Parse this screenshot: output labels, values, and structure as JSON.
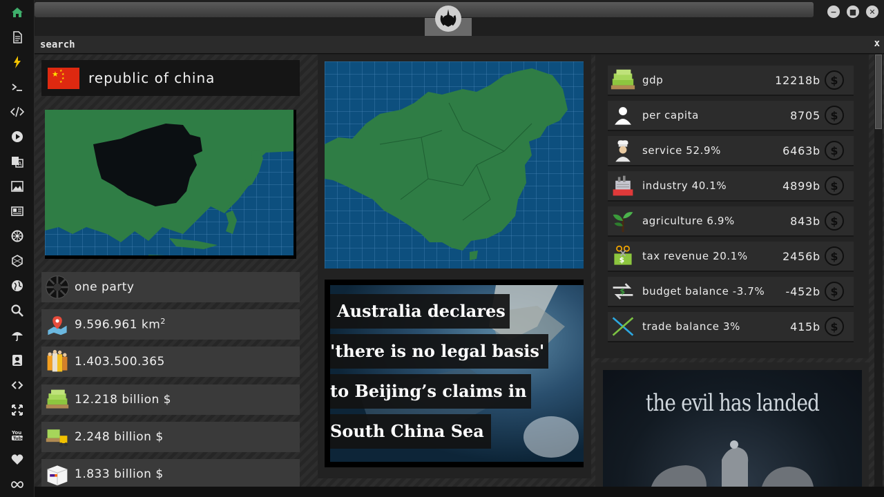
{
  "search": {
    "placeholder": "search",
    "close_label": "x"
  },
  "sidebar": {
    "items": [
      {
        "name": "home-icon"
      },
      {
        "name": "document-icon"
      },
      {
        "name": "lightning-icon"
      },
      {
        "name": "terminal-icon"
      },
      {
        "name": "code-icon"
      },
      {
        "name": "play-icon"
      },
      {
        "name": "translate-icon"
      },
      {
        "name": "image-icon"
      },
      {
        "name": "news-icon"
      },
      {
        "name": "gear-icon"
      },
      {
        "name": "hexagon-icon"
      },
      {
        "name": "globe-icon"
      },
      {
        "name": "search-icon"
      },
      {
        "name": "umbrella-icon"
      },
      {
        "name": "contact-icon"
      },
      {
        "name": "link-icon"
      },
      {
        "name": "expand-icon"
      },
      {
        "name": "youtube-icon"
      },
      {
        "name": "heart-icon"
      },
      {
        "name": "infinity-icon"
      }
    ]
  },
  "window": {
    "minimize": "−",
    "maximize": "■",
    "close": "✕"
  },
  "country": {
    "name": "republic of china",
    "stats": {
      "government": "one party",
      "area": "9.596.961 km",
      "area_unit_sup": "2",
      "population": "1.403.500.365",
      "gdp": "12.218 billion $",
      "budget": "2.248 billion $",
      "imports": "1.833 billion $"
    }
  },
  "news": {
    "line1": "Australia declares",
    "line2": "'there is no legal basis'",
    "line3": "to Beijing’s claims in",
    "line4": "South China Sea"
  },
  "economy": [
    {
      "label": "gdp",
      "value": "12218b",
      "icon": "cash-stack-icon"
    },
    {
      "label": "per capita",
      "value": "8705",
      "icon": "person-icon"
    },
    {
      "label": "service 52.9%",
      "value": "6463b",
      "icon": "chef-icon"
    },
    {
      "label": "industry 40.1%",
      "value": "4899b",
      "icon": "factory-icon"
    },
    {
      "label": "agriculture 6.9%",
      "value": "843b",
      "icon": "sprout-icon"
    },
    {
      "label": "tax revenue 20.1%",
      "value": "2456b",
      "icon": "tax-scissors-icon"
    },
    {
      "label": "budget balance -3.7%",
      "value": "-452b",
      "icon": "transfer-arrows-icon"
    },
    {
      "label": "trade balance 3%",
      "value": "415b",
      "icon": "trade-cross-icon"
    }
  ],
  "dollar_symbol": "$",
  "promo": {
    "title": "the evil has landed"
  },
  "colors": {
    "ocean": "#0d4f7e",
    "land": "#2f7d45",
    "china_dark": "#0b0f12",
    "flag_red": "#de2910",
    "flag_yellow": "#ffde00"
  }
}
